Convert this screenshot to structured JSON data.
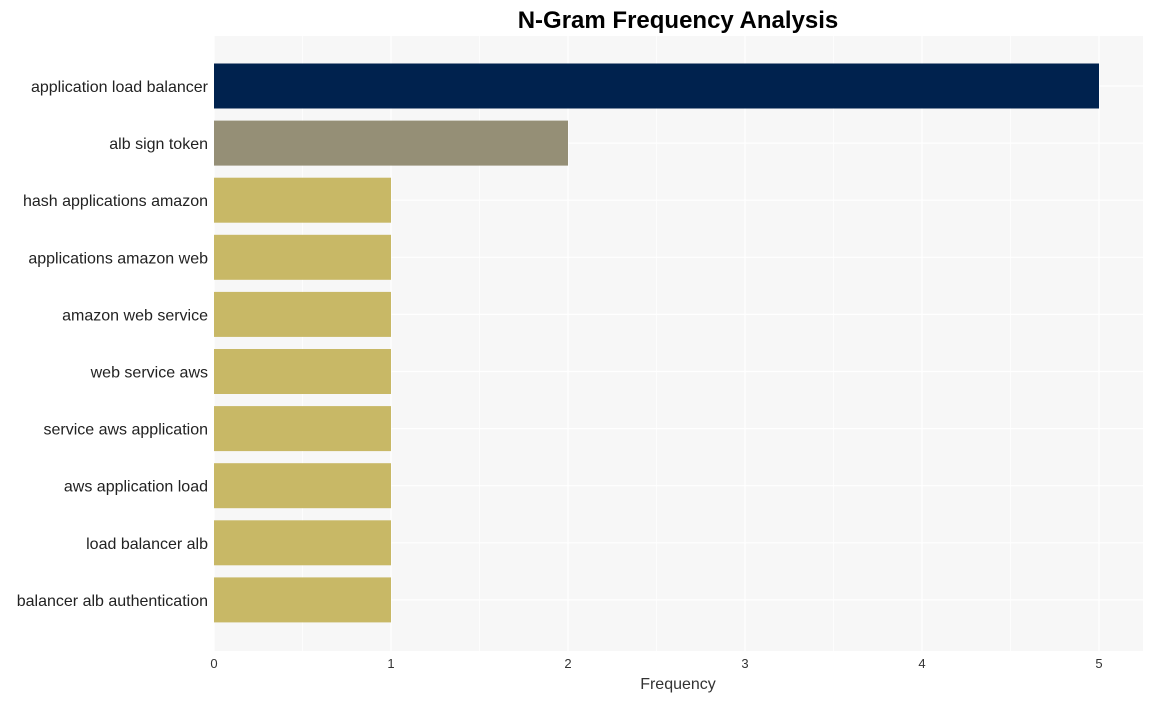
{
  "chart_data": {
    "type": "bar",
    "orientation": "horizontal",
    "title": "N-Gram Frequency Analysis",
    "xlabel": "Frequency",
    "ylabel": "",
    "xlim": [
      0,
      5.25
    ],
    "xticks": [
      0,
      1,
      2,
      3,
      4,
      5
    ],
    "grid": true,
    "legend": "none",
    "categories": [
      "application load balancer",
      "alb sign token",
      "hash applications amazon",
      "applications amazon web",
      "amazon web service",
      "web service aws",
      "service aws application",
      "aws application load",
      "load balancer alb",
      "balancer alb authentication"
    ],
    "values": [
      5,
      2,
      1,
      1,
      1,
      1,
      1,
      1,
      1,
      1
    ],
    "colors": [
      "#00224e",
      "#958f76",
      "#c8b866",
      "#c8b866",
      "#c8b866",
      "#c8b866",
      "#c8b866",
      "#c8b866",
      "#c8b866",
      "#c8b866"
    ],
    "panel_background": "#f7f7f7",
    "grid_color": "#ffffff"
  }
}
